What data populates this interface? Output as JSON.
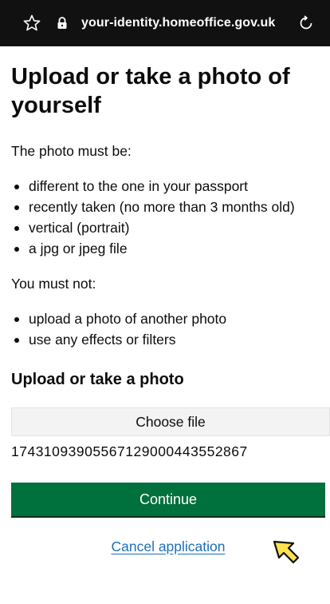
{
  "browser": {
    "url": "your-identity.homeoffice.gov.uk",
    "icons": [
      "star-icon",
      "lock-icon",
      "reload-icon"
    ]
  },
  "main": {
    "heading": "Upload or take a photo of yourself",
    "intro": "The photo must be:",
    "requirements": [
      "different to the one in your passport",
      "recently taken (no more than 3 months old)",
      "vertical (portrait)",
      "a jpg or jpeg file"
    ],
    "must_not_intro": "You must not:",
    "must_not": [
      "upload a photo of another photo",
      "use any effects or filters"
    ],
    "upload_heading": "Upload or take a photo",
    "choose_file_label": "Choose file",
    "file_name": "17431093905567129000443552867",
    "continue_label": "Continue",
    "cancel_label": "Cancel application"
  },
  "colors": {
    "primary_button": "#00703c",
    "link": "#1d70b8",
    "text": "#0b0c0c",
    "urlbar": "#111111"
  }
}
